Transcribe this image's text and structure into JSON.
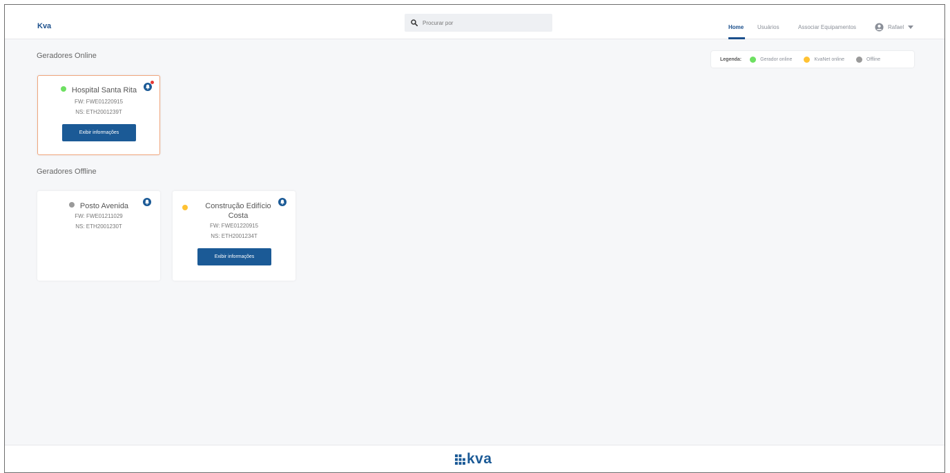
{
  "header": {
    "brand": "Kva",
    "search_placeholder": "Procurar por",
    "nav": [
      "Home",
      "Usuários",
      "Associar Equipamentos"
    ],
    "user": "Rafael"
  },
  "legend": {
    "label": "Legenda:",
    "items": [
      {
        "label": "Gerador online",
        "color": "#6ee062"
      },
      {
        "label": "KvaNet online",
        "color": "#ffc233"
      },
      {
        "label": "Offline",
        "color": "#9a9a9a"
      }
    ]
  },
  "online": {
    "title": "Geradores Online",
    "cards": [
      {
        "name": "Hospital Santa Rita",
        "fw": "FW: FWE01220915",
        "ns": "NS: ETH2001239T",
        "status_color": "#6ee062",
        "button": "Exibir informações",
        "notification": true
      }
    ]
  },
  "offline": {
    "title": "Geradores Offline",
    "cards": [
      {
        "name": "Posto Avenida",
        "fw": "FW: FWE01211029",
        "ns": "NS: ETH2001230T",
        "status_color": "#9a9a9a"
      },
      {
        "name_line1": "Construção Edifício",
        "name_line2": "Costa",
        "fw": "FW: FWE01220915",
        "ns": "NS: ETH2001234T",
        "status_color": "#ffc233",
        "button": "Exibir informações"
      }
    ]
  },
  "footer": {
    "logo_text": "kva"
  },
  "colors": {
    "primary": "#1b5a96",
    "alert_border": "#f0a57c",
    "badge": "#e53935"
  }
}
